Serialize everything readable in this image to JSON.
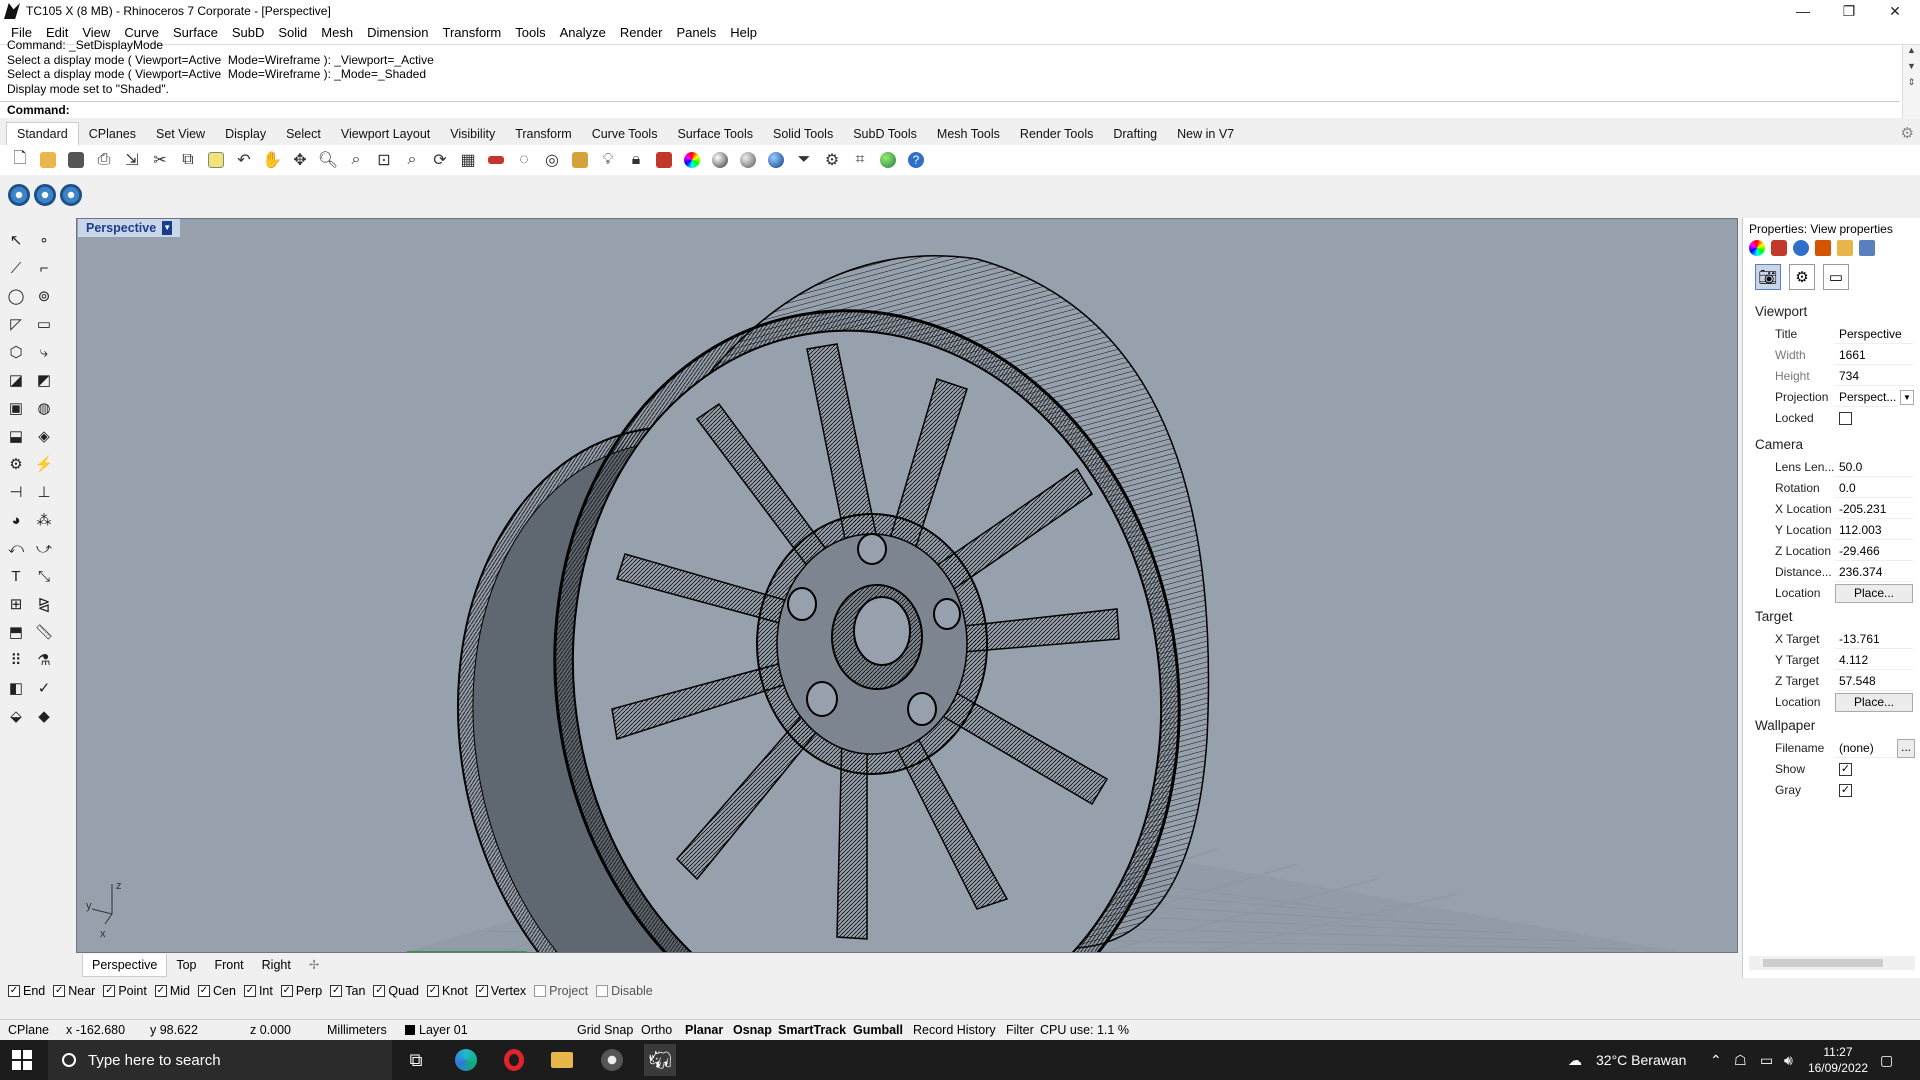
{
  "window": {
    "title": "TC105 X (8 MB) - Rhinoceros 7 Corporate - [Perspective]",
    "minimize": "—",
    "maximize": "❐",
    "close": "✕"
  },
  "menu": [
    "File",
    "Edit",
    "View",
    "Curve",
    "Surface",
    "SubD",
    "Solid",
    "Mesh",
    "Dimension",
    "Transform",
    "Tools",
    "Analyze",
    "Render",
    "Panels",
    "Help"
  ],
  "command": {
    "history": [
      "Command: _SetDisplayMode",
      "Select a display mode ( Viewport=Active  Mode=Wireframe ): _Viewport=_Active",
      "Select a display mode ( Viewport=Active  Mode=Wireframe ): _Mode=_Shaded",
      "Display mode set to \"Shaded\"."
    ],
    "prompt": "Command:"
  },
  "toolbar_tabs": [
    "Standard",
    "CPlanes",
    "Set View",
    "Display",
    "Select",
    "Viewport Layout",
    "Visibility",
    "Transform",
    "Curve Tools",
    "Surface Tools",
    "Solid Tools",
    "SubD Tools",
    "Mesh Tools",
    "Render Tools",
    "Drafting",
    "New in V7"
  ],
  "toolbar_icons": [
    "new-file-icon",
    "open-icon",
    "save-icon",
    "print-icon",
    "import-icon",
    "cut-icon",
    "copy-icon",
    "paste-icon",
    "undo-icon",
    "pan-icon",
    "move-view-icon",
    "zoom-icon",
    "zoom-window-icon",
    "zoom-extents-icon",
    "zoom-selected-icon",
    "rotate-view-icon",
    "grid-icon",
    "car-icon",
    "hide-icon",
    "show-icon",
    "lock-objects-icon",
    "light-icon",
    "lock-icon",
    "materials-icon",
    "color-wheel-icon",
    "sphere-icon",
    "render-preview-icon",
    "rendered-sphere-icon",
    "filter-icon",
    "options-icon",
    "snap-icon",
    "globe-icon",
    "help-icon"
  ],
  "viewport": {
    "label": "Perspective",
    "tabs": [
      "Perspective",
      "Top",
      "Front",
      "Right"
    ],
    "axis": {
      "x": "x",
      "y": "y",
      "z": "z"
    }
  },
  "osnaps": [
    {
      "label": "End",
      "checked": true
    },
    {
      "label": "Near",
      "checked": true
    },
    {
      "label": "Point",
      "checked": true
    },
    {
      "label": "Mid",
      "checked": true
    },
    {
      "label": "Cen",
      "checked": true
    },
    {
      "label": "Int",
      "checked": true
    },
    {
      "label": "Perp",
      "checked": true
    },
    {
      "label": "Tan",
      "checked": true
    },
    {
      "label": "Quad",
      "checked": true
    },
    {
      "label": "Knot",
      "checked": true
    },
    {
      "label": "Vertex",
      "checked": true
    },
    {
      "label": "Project",
      "checked": false
    },
    {
      "label": "Disable",
      "checked": false
    }
  ],
  "status": {
    "cplane": "CPlane",
    "x": "x -162.680",
    "y": "y 98.622",
    "z": "z 0.000",
    "units": "Millimeters",
    "layer": "Layer 01",
    "grid_snap": "Grid Snap",
    "ortho": "Ortho",
    "planar": "Planar",
    "osnap": "Osnap",
    "smarttrack": "SmartTrack",
    "gumball": "Gumball",
    "record_history": "Record History",
    "filter": "Filter",
    "cpu": "CPU use: 1.1 %"
  },
  "properties": {
    "header": "Properties: View properties",
    "viewport_section": "Viewport",
    "title_label": "Title",
    "title_value": "Perspective",
    "width_label": "Width",
    "width_value": "1661",
    "height_label": "Height",
    "height_value": "734",
    "projection_label": "Projection",
    "projection_value": "Perspect...",
    "locked_label": "Locked",
    "camera_section": "Camera",
    "lens_label": "Lens Len...",
    "lens_value": "50.0",
    "rotation_label": "Rotation",
    "rotation_value": "0.0",
    "xloc_label": "X Location",
    "xloc_value": "-205.231",
    "yloc_label": "Y Location",
    "yloc_value": "112.003",
    "zloc_label": "Z Location",
    "zloc_value": "-29.466",
    "distance_label": "Distance...",
    "distance_value": "236.374",
    "location_label": "Location",
    "place_button": "Place...",
    "target_section": "Target",
    "xtarget_label": "X Target",
    "xtarget_value": "-13.761",
    "ytarget_label": "Y Target",
    "ytarget_value": "4.112",
    "ztarget_label": "Z Target",
    "ztarget_value": "57.548",
    "wallpaper_section": "Wallpaper",
    "filename_label": "Filename",
    "filename_value": "(none)",
    "browse_button": "...",
    "show_label": "Show",
    "gray_label": "Gray"
  },
  "taskbar": {
    "search_placeholder": "Type here to search",
    "weather": "32°C  Berawan",
    "time": "11:27",
    "date": "16/09/2022"
  }
}
